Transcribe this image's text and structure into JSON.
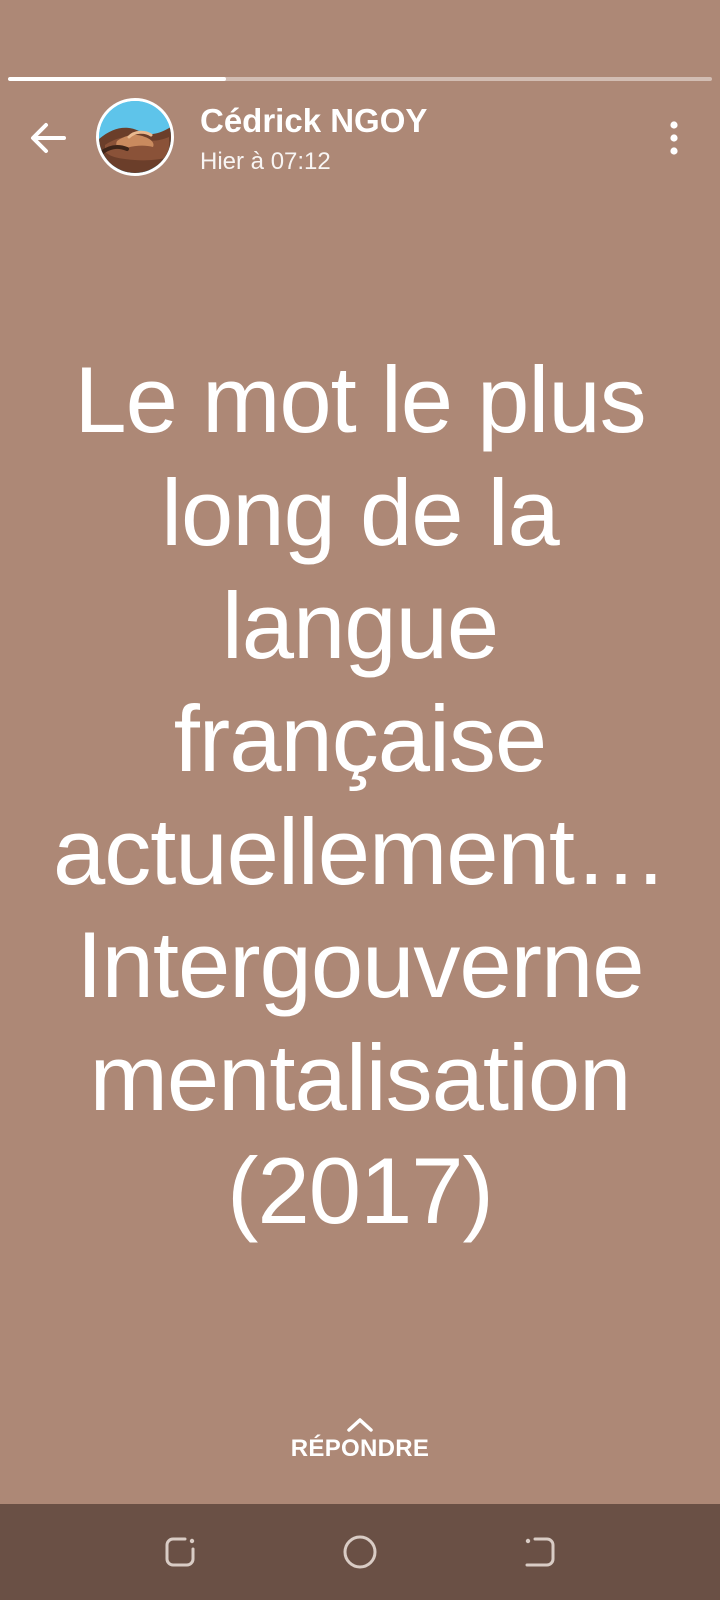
{
  "story": {
    "progress": 0.31,
    "background_color": "#ad8876",
    "author_name": "Cédrick NGOY",
    "timestamp": "Hier à 07:12",
    "text": "Le mot le plus\nlong de la\nlangue\nfrançaise\nactuellement…\nIntergouverne\nmentalisation\n(2017)"
  },
  "header": {
    "back_icon": "arrow-left-icon",
    "more_icon": "more-vertical-icon"
  },
  "reply": {
    "icon": "chevron-up-icon",
    "label": "RÉPONDRE"
  },
  "navbar": {
    "color": "#6a5045",
    "buttons": [
      "recents-icon",
      "home-icon",
      "back-icon"
    ]
  }
}
